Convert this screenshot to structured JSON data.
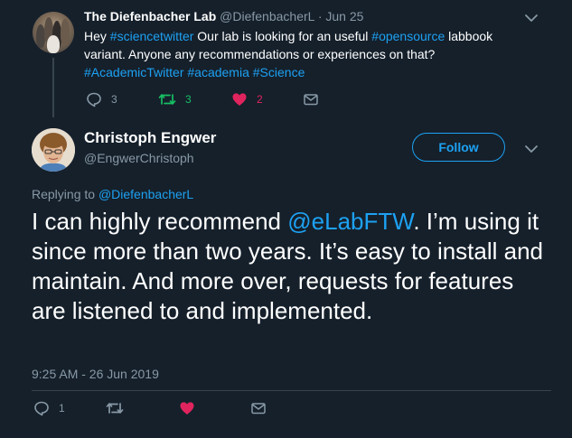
{
  "parent_tweet": {
    "author_name": "The Diefenbacher Lab",
    "author_handle": "@DiefenbacherL",
    "separator": "·",
    "date": "Jun 25",
    "text": {
      "t1": "Hey ",
      "h1": "#sciencetwitter",
      "t2": " Our lab is looking for an useful  ",
      "h2": "#opensource",
      "t3": " labbook variant. Anyone any recommendations or experiences on that? ",
      "h3": "#AcademicTwitter",
      "t4": "  ",
      "h4": "#academia",
      "t5": " ",
      "h5": "#Science"
    },
    "reply_count": "3",
    "retweet_count": "3",
    "like_count": "2"
  },
  "main_tweet": {
    "author_name": "Christoph Engwer",
    "author_handle": "@EngwerChristoph",
    "follow_label": "Follow",
    "replying_prefix": "Replying to ",
    "replying_to": "@DiefenbacherL",
    "text": {
      "t1": "I can highly recommend ",
      "mention": "@eLabFTW",
      "t2": ". I’m using it since more than two years. It’s easy to install and maintain. And more over, requests for features are listened to and implemented."
    },
    "timestamp": "9:25 AM - 26 Jun 2019",
    "reply_count": "1"
  },
  "colors": {
    "background": "#15202b",
    "accent": "#1da1f2",
    "muted": "#8899a6",
    "retweet_active": "#17bf63",
    "like_active": "#e0245e",
    "divider": "#38444d"
  },
  "icons": [
    "reply-icon",
    "retweet-icon",
    "like-icon",
    "message-icon",
    "chevron-down-icon",
    "follow-button"
  ]
}
